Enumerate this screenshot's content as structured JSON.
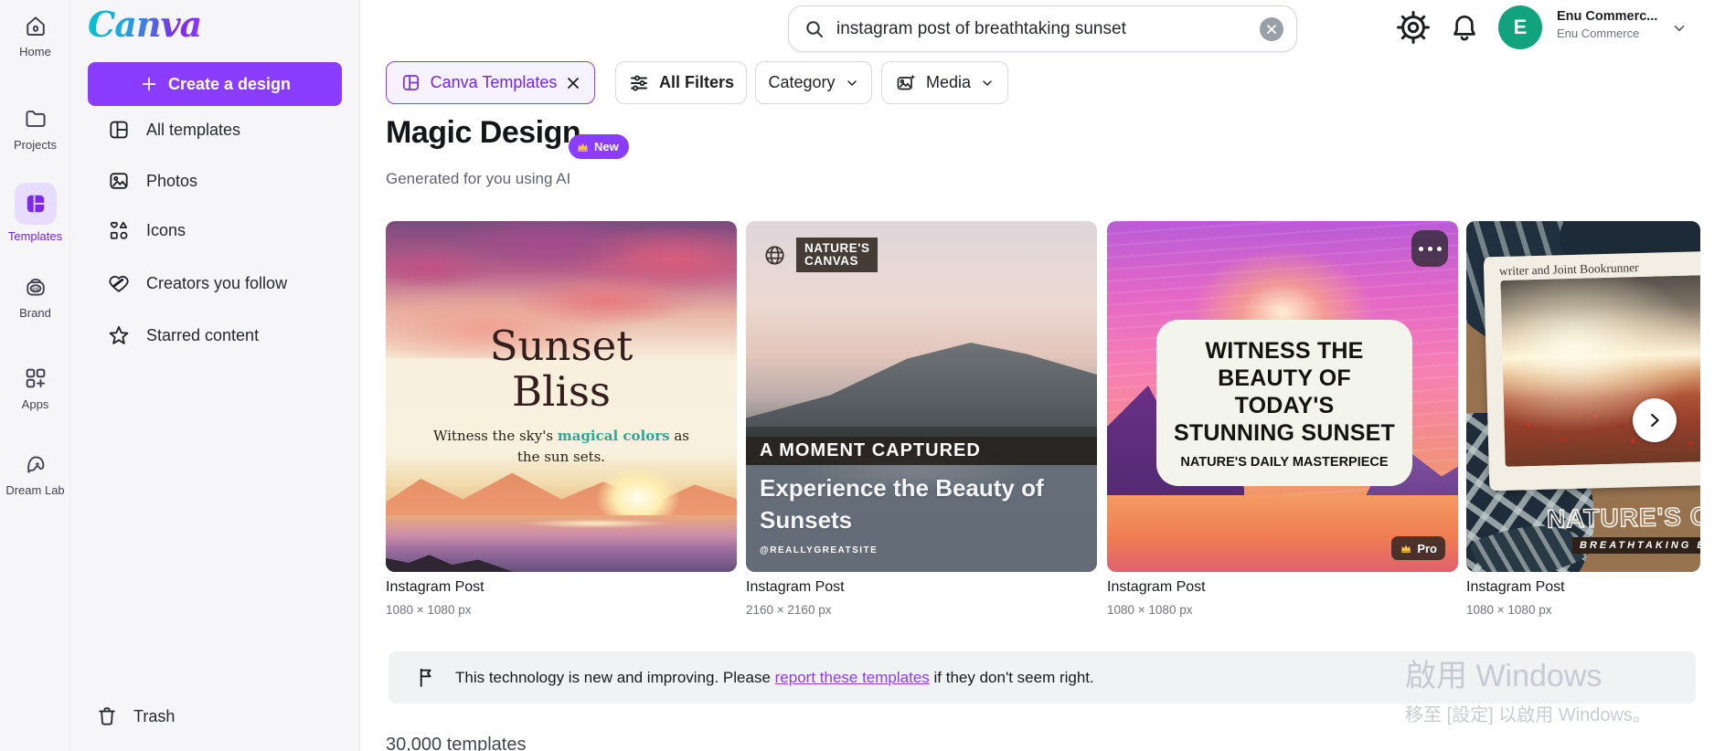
{
  "rail": {
    "items": [
      {
        "label": "Home"
      },
      {
        "label": "Projects"
      },
      {
        "label": "Templates"
      },
      {
        "label": "Brand"
      },
      {
        "label": "Apps"
      },
      {
        "label": "Dream Lab"
      }
    ]
  },
  "sidebar": {
    "logo": "Canva",
    "create_label": "Create a design",
    "items": [
      {
        "label": "All templates"
      },
      {
        "label": "Photos"
      },
      {
        "label": "Icons"
      },
      {
        "label": "Creators you follow"
      },
      {
        "label": "Starred content"
      }
    ],
    "trash_label": "Trash"
  },
  "topbar": {
    "search_value": "instagram post of breathtaking sunset",
    "account_name": "Enu Commerc...",
    "account_company": "Enu Commerce",
    "avatar_initial": "E"
  },
  "filters": {
    "canva_templates": "Canva Templates",
    "all_filters": "All Filters",
    "category": "Category",
    "media": "Media"
  },
  "header": {
    "title": "Magic Design",
    "new_badge": "New",
    "subtitle": "Generated for you using AI"
  },
  "cards": [
    {
      "title": "Instagram Post",
      "size": "1080 × 1080 px",
      "design": {
        "title_line1": "Sunset",
        "title_line2": "Bliss",
        "tag_pre": "Witness the sky's ",
        "tag_highlight": "magical colors",
        "tag_post": " as",
        "tag_line2": "the sun sets."
      }
    },
    {
      "title": "Instagram Post",
      "size": "2160 × 2160 px",
      "design": {
        "badge_line1": "NATURE'S",
        "badge_line2": "CANVAS",
        "band": "A MOMENT CAPTURED",
        "line1": "Experience the Beauty of",
        "line2": "Sunsets",
        "handle": "@REALLYGREATSITE"
      }
    },
    {
      "title": "Instagram Post",
      "size": "1080 × 1080 px",
      "design": {
        "line1": "WITNESS THE",
        "line2": "BEAUTY OF",
        "line3": "TODAY'S",
        "line4": "STUNNING SUNSET",
        "subline": "NATURE'S DAILY MASTERPIECE",
        "pro_label": "Pro"
      }
    },
    {
      "title": "Instagram Post",
      "size": "1080 × 1080 px",
      "design": {
        "news": "writer and Joint Bookrunner",
        "title": "NATURE'S CANVAS",
        "subtitle": "BREATHTAKING BEAUTY"
      }
    }
  ],
  "notice": {
    "pre": "This technology is new and improving. Please ",
    "link": "report these templates",
    "post": " if they don't seem right."
  },
  "watermark": {
    "line1": "啟用 Windows",
    "line2": "移至 [設定] 以啟用 Windows。"
  },
  "footer": {
    "count": "30,000 templates"
  },
  "colors": {
    "accent": "#8b3dff",
    "avatar": "#10a37e"
  }
}
